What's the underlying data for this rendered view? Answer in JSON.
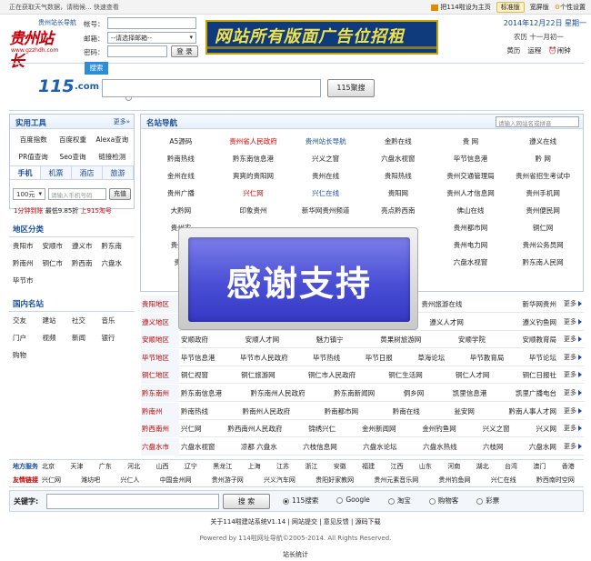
{
  "topbar": {
    "weather": "正在获取天气数据，请稍候... 快速查看",
    "set_home": "把114啦设为主页",
    "standard": "标准版",
    "wide": "宽屏版",
    "personal": "个性设置"
  },
  "header": {
    "logo_text": "贵州站长",
    "logo_sub": "www.gzzhdh.com",
    "site_nav": "贵州站长导航",
    "account_label": "帐号：",
    "mailbox_label": "邮箱：",
    "mailbox_select": "--请选择邮箱--",
    "password_label": "密码：",
    "login": "登 录",
    "banner_text": "网站所有版面广告位招租",
    "date": "2014年12月22日 星期一",
    "lunar": "农历 十一月初一",
    "huangli": "黄历",
    "yuncheng": "运程",
    "alarm": "闹钟"
  },
  "search115": {
    "logo": "115",
    "logo_dot": ".com",
    "tab": "搜索",
    "button": "115聚搜"
  },
  "left": {
    "tools_title": "实用工具",
    "tools_more": "更多»",
    "tools": [
      "百度指数",
      "百度权重",
      "Alexa查询",
      "PR值查询",
      "Seo查询",
      "链接检测"
    ],
    "tabs": [
      "手机",
      "机票",
      "酒店",
      "旅游"
    ],
    "amount": "100元",
    "phone_placeholder": "请输入手机号码",
    "recharge": "充值",
    "promo_a": "1分钟到账",
    "promo_b": "最低9.85折",
    "promo_c": "上915淘号",
    "region_title": "地区分类",
    "regions": [
      "贵阳市",
      "安顺市",
      "遵义市",
      "黔东南",
      "黔南州",
      "铜仁市",
      "黔西南",
      "六盘水",
      "毕节市"
    ],
    "intl_title": "国内名站",
    "intl": [
      "交友",
      "建站",
      "社交",
      "音乐",
      "门户",
      "视频",
      "新闻",
      "银行",
      "购物"
    ]
  },
  "famous": {
    "title": "名站导航",
    "search_placeholder": "请输入网站名或拼音",
    "rows": [
      [
        {
          "t": "A5源码",
          "c": ""
        },
        {
          "t": "贵州省人民政府",
          "c": "red"
        },
        {
          "t": "贵州站长导航",
          "c": "blue"
        },
        {
          "t": "金黔在线",
          "c": ""
        },
        {
          "t": "贵 网",
          "c": ""
        },
        {
          "t": "遵义在线",
          "c": ""
        }
      ],
      [
        {
          "t": "黔南热线",
          "c": ""
        },
        {
          "t": "黔东南信息港",
          "c": ""
        },
        {
          "t": "兴义之窗",
          "c": ""
        },
        {
          "t": "六盘水视窗",
          "c": ""
        },
        {
          "t": "毕节信息港",
          "c": ""
        },
        {
          "t": "黔 网",
          "c": ""
        }
      ],
      [
        {
          "t": "金州在线",
          "c": ""
        },
        {
          "t": "爽爽的贵阳网",
          "c": ""
        },
        {
          "t": "贵州在线",
          "c": ""
        },
        {
          "t": "贵阳热线",
          "c": ""
        },
        {
          "t": "贵州交通管理局",
          "c": ""
        },
        {
          "t": "贵州省招生考试中",
          "c": ""
        }
      ],
      [
        {
          "t": "贵州广播",
          "c": ""
        },
        {
          "t": "兴仁网",
          "c": "red"
        },
        {
          "t": "兴仁在线",
          "c": "blue"
        },
        {
          "t": "贵阳网",
          "c": ""
        },
        {
          "t": "贵州人才信息网",
          "c": ""
        },
        {
          "t": "贵州手机网",
          "c": ""
        }
      ],
      [
        {
          "t": "大黔网",
          "c": ""
        },
        {
          "t": "印象贵州",
          "c": ""
        },
        {
          "t": "新华网贵州频道",
          "c": ""
        },
        {
          "t": "亮点黔西南",
          "c": ""
        },
        {
          "t": "佛山在线",
          "c": ""
        },
        {
          "t": "贵州便民网",
          "c": ""
        }
      ],
      [
        {
          "t": "贵州农",
          "c": ""
        },
        {
          "t": "",
          "c": ""
        },
        {
          "t": "",
          "c": ""
        },
        {
          "t": "",
          "c": ""
        },
        {
          "t": "贵州都市网",
          "c": ""
        },
        {
          "t": "铜仁网",
          "c": ""
        }
      ],
      [
        {
          "t": "贵州省",
          "c": ""
        },
        {
          "t": "",
          "c": ""
        },
        {
          "t": "",
          "c": ""
        },
        {
          "t": "",
          "c": ""
        },
        {
          "t": "贵州电力网",
          "c": ""
        },
        {
          "t": "贵州公务员网",
          "c": ""
        }
      ],
      [
        {
          "t": "贵州",
          "c": ""
        },
        {
          "t": "",
          "c": ""
        },
        {
          "t": "",
          "c": ""
        },
        {
          "t": "区",
          "c": ""
        },
        {
          "t": "六盘水视窗",
          "c": ""
        },
        {
          "t": "黔东南人民网",
          "c": ""
        }
      ]
    ]
  },
  "region_rows": [
    {
      "name": "贵阳地区",
      "items": [
        "",
        "",
        "",
        "",
        "贵州旅游在线",
        "新华网贵州"
      ],
      "more": "更多"
    },
    {
      "name": "遵义地区",
      "items": [
        "",
        "",
        "",
        "在线",
        "遵义人才网",
        "遵义钓鱼网"
      ],
      "more": "更多"
    },
    {
      "name": "安顺地区",
      "items": [
        "安顺政府",
        "安顺人才网",
        "魅力镇宁",
        "黄果树旅游网",
        "安顺学院",
        "安顺教育局"
      ],
      "more": "更多"
    },
    {
      "name": "毕节地区",
      "items": [
        "毕节信息港",
        "毕节市人民政府",
        "毕节热线",
        "毕节日报",
        "草海论坛",
        "毕节教育局",
        "毕节论坛"
      ],
      "more": "更多"
    },
    {
      "name": "铜仁地区",
      "items": [
        "铜仁视窗",
        "铜仁旅游网",
        "铜仁市人民政府",
        "铜仁生活网",
        "铜仁人才网",
        "铜仁日报社"
      ],
      "more": "更多"
    },
    {
      "name": "黔东南州",
      "items": [
        "黔东南信息港",
        "黔东南州人民政府",
        "黔东南新闻网",
        "侗乡网",
        "凯里信息港",
        "凯里广播电台"
      ],
      "more": "更多"
    },
    {
      "name": "黔南州",
      "items": [
        "黔南热线",
        "黔南州人民政府",
        "黔南都市网",
        "黔南在线",
        "瓮安网",
        "黔南人事人才网"
      ],
      "more": "更多"
    },
    {
      "name": "黔西南州",
      "items": [
        "兴仁网",
        "黔西南州人民政府",
        "锦绣兴仁",
        "金州新闻网",
        "金州钓鱼网",
        "兴义之窗",
        "兴义网"
      ],
      "more": "更多"
    },
    {
      "name": "六盘水市",
      "items": [
        "六盘水视窗",
        "凉都 六盘水",
        "六枝信息网",
        "六盘水论坛",
        "六盘水热线",
        "六枝网",
        "六盘水网"
      ],
      "more": "更多"
    }
  ],
  "local_service": {
    "label": "地方服务",
    "items": [
      "北京",
      "天津",
      "广东",
      "河北",
      "山西",
      "辽宁",
      "黑龙江",
      "上海",
      "江苏",
      "浙江",
      "安徽",
      "福建",
      "江西",
      "山东",
      "河南",
      "湖北",
      "台湾",
      "澳门",
      "香港"
    ]
  },
  "friend_links": {
    "label": "友情链接",
    "items": [
      "兴仁网",
      "潍坊吧",
      "兴仁人",
      "中国金州网",
      "贵州游子网",
      "兴义汽车网",
      "贵阳好家教网",
      "贵州元素音乐网",
      "贵州钓鱼网",
      "兴仁在线",
      "黔西南时空网"
    ]
  },
  "bottom_search": {
    "label": "关键字:",
    "button": "搜 索",
    "options": [
      "115搜索",
      "Google",
      "淘宝",
      "购物客",
      "彩票"
    ],
    "selected": 0
  },
  "footer": {
    "links": [
      "关于114啦建站系统V1.14",
      "网站提交",
      "意见反馈",
      "源码下载"
    ],
    "copyright": "Powered by 114啦网址导航©2005-2014. All Rights Reserved.",
    "stats": "站长统计"
  },
  "overlay": {
    "text": "感谢支持"
  },
  "colors": {
    "accent_blue": "#1a4fa0",
    "accent_red": "#c00000",
    "overlay_blue": "#4a4fd6"
  }
}
